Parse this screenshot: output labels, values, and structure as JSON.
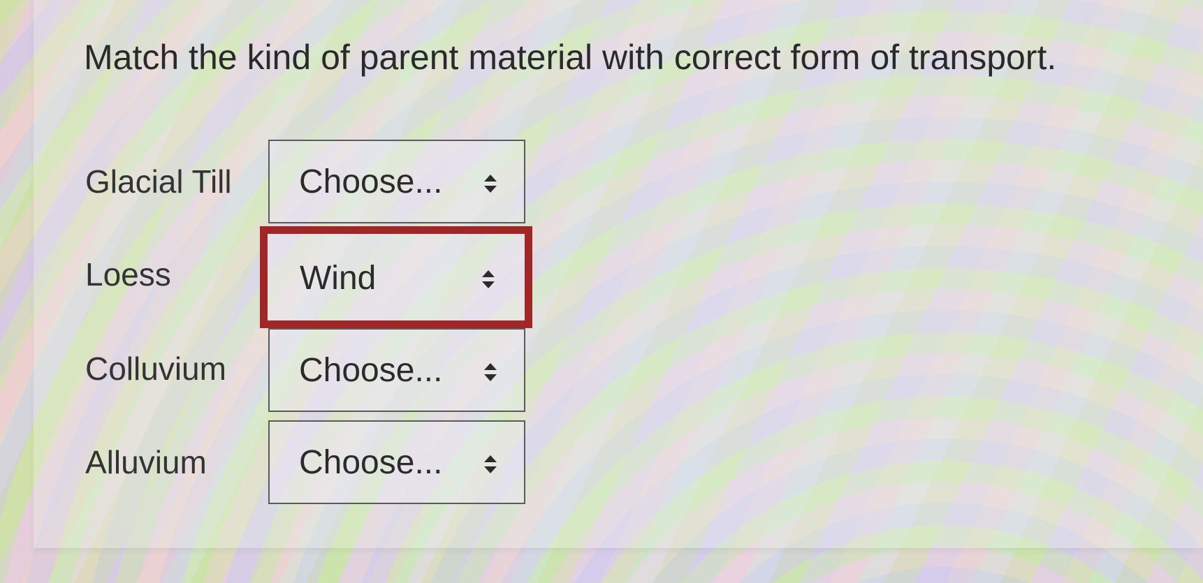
{
  "question": "Match the kind of parent material with correct form of transport.",
  "rows": [
    {
      "label": "Glacial Till",
      "selected": "Choose..."
    },
    {
      "label": "Loess",
      "selected": "Wind"
    },
    {
      "label": "Colluvium",
      "selected": "Choose..."
    },
    {
      "label": "Alluvium",
      "selected": "Choose..."
    }
  ],
  "colors": {
    "highlight_border": "#a02628",
    "select_border": "#5a5a5a",
    "text": "#2b2b2b"
  },
  "icons": {
    "select_arrows": "up-down-chevron-icon"
  }
}
